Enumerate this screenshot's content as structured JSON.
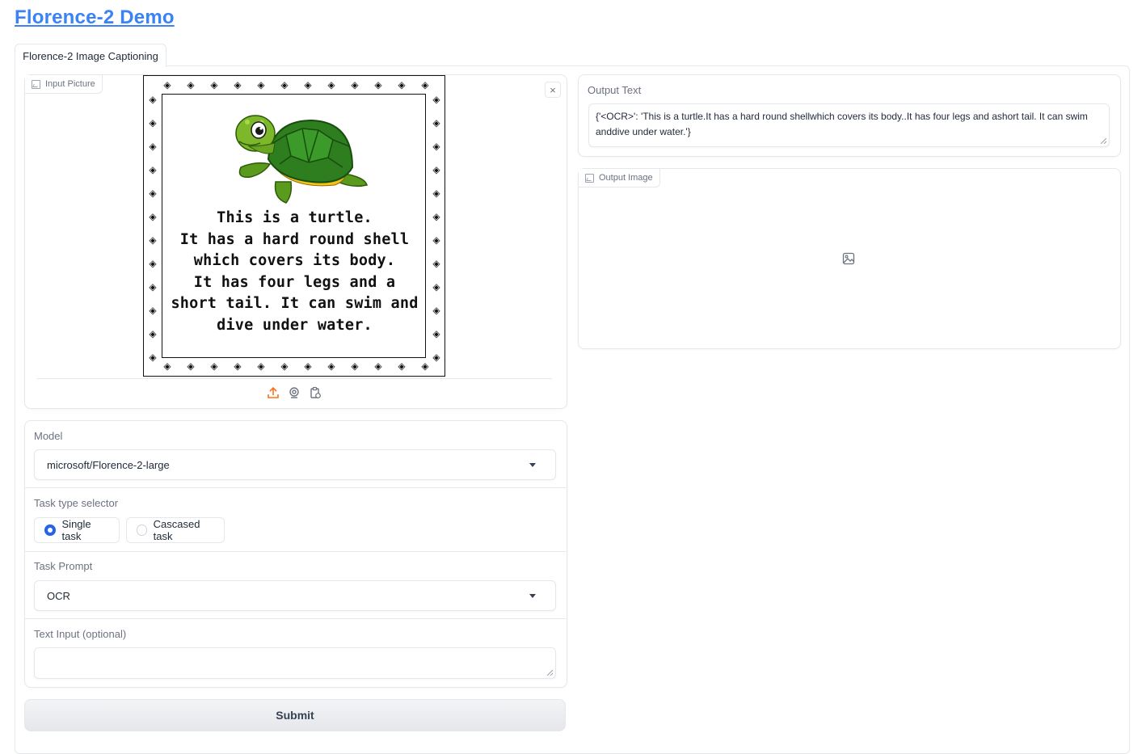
{
  "header": {
    "title": "Florence-2 Demo"
  },
  "tabs": [
    {
      "label": "Florence-2 Image Captioning"
    }
  ],
  "input_picture": {
    "label": "Input Picture",
    "caption_lines": [
      "This is a turtle.",
      "It has a hard round shell",
      "which covers its body.",
      "It has four legs and a",
      "short tail. It can swim and",
      "dive under water."
    ]
  },
  "model": {
    "label": "Model",
    "value": "microsoft/Florence-2-large"
  },
  "task_type": {
    "label": "Task type selector",
    "options": [
      {
        "label": "Single task",
        "selected": true
      },
      {
        "label": "Cascased task",
        "selected": false
      }
    ]
  },
  "task_prompt": {
    "label": "Task Prompt",
    "value": "OCR"
  },
  "text_input": {
    "label": "Text Input (optional)",
    "value": ""
  },
  "submit": {
    "label": "Submit"
  },
  "output_text": {
    "label": "Output Text",
    "value": "{'<OCR>': 'This is a turtle.It has a hard round shellwhich covers its body..It has four legs and ashort tail. It can swim anddive under water.'}"
  },
  "output_image": {
    "label": "Output Image"
  },
  "colors": {
    "accent": "#2563eb",
    "title": "#3b82f6",
    "upload_icon": "#f97316"
  }
}
